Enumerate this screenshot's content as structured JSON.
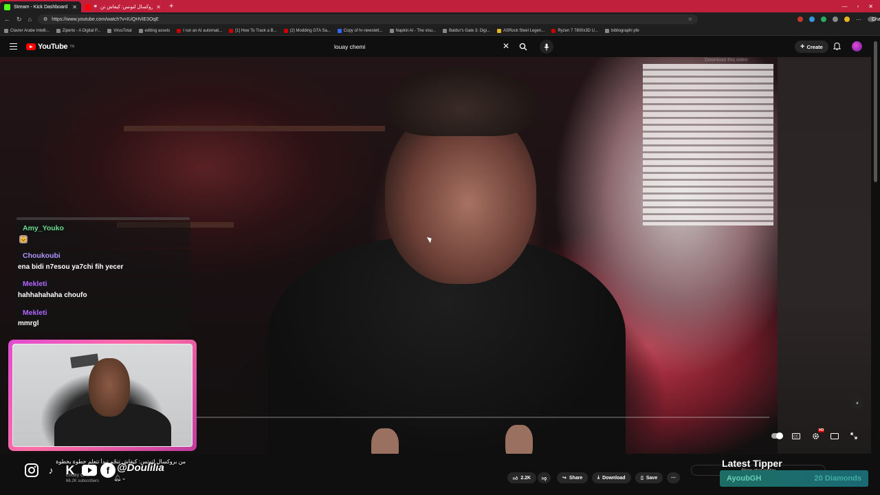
{
  "browser": {
    "tabs": [
      {
        "title": "Stream - Kick Dashboard",
        "active": true,
        "favicon_color": "#53fc18"
      },
      {
        "title": "من بروكسال لتونس: كيفاش تن",
        "active": false,
        "favicon_color": "#ff0000"
      }
    ],
    "new_tab_label": "+",
    "url": "https://www.youtube.com/watch?v=IUQHViE3OqE",
    "chat_label": "Chat",
    "bookmarks": [
      "Clavier Arabe Intelli...",
      "Ziperto - A Digital P...",
      "VirusTotal",
      "editing assets",
      "I run an AI automati...",
      "[1] How To Track a B...",
      "(2) Modding GTA Sa...",
      "Copy of hr-newslett...",
      "Napkin AI - The visu...",
      "Baldur's Gate 3: Digi...",
      "ASRock Steel Legen...",
      "Ryzen 7 7800x3D U...",
      "bibliographi pfe"
    ]
  },
  "youtube": {
    "logo_text": "YouTube",
    "logo_sup": "TN",
    "search_query": "louay chemi",
    "create_label": "Create",
    "video": {
      "title": "من بروكسال لتونس: كيفاش تنجّم تبدأ تتعلم خطوة بخطوة",
      "channel": "Louay Chemi",
      "subscribers": "66.2K subscribers",
      "likes": "2.2K",
      "share_label": "Share",
      "download_label": "Download",
      "save_label": "Save",
      "download_hint": "Download this video",
      "quality_badge": "HD"
    }
  },
  "stream_overlay": {
    "chat": [
      {
        "user": "Amy_Youko",
        "color": "#6bdc8f",
        "text": ""
      },
      {
        "user": "Choukoubi",
        "color": "#b593ff",
        "text": "ena bidi n7esou ya7chi fih yecer"
      },
      {
        "user": "Mekleti",
        "color": "#b266ff",
        "text": "hahhahahaha choufo"
      },
      {
        "user": "Mekleti",
        "color": "#b266ff",
        "text": "mmrgl"
      }
    ],
    "social_handle": "@Doulilia",
    "latest_tipper_label": "Latest Tipper",
    "show_chat_replay": "Show chat replay",
    "tipper_name": "AyoubGH",
    "tipper_amount": "20 Diamonds",
    "accent_color": "#e14bd0"
  }
}
